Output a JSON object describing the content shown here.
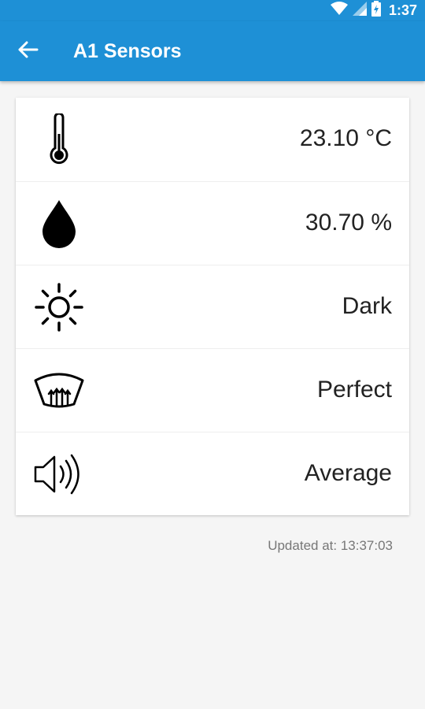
{
  "status_bar": {
    "time": "1:37",
    "icons": [
      "wifi-icon",
      "cell-signal-icon",
      "battery-icon"
    ]
  },
  "app_bar": {
    "title": "A1 Sensors",
    "back_icon": "arrow-left-icon",
    "color": "#1e90d6"
  },
  "sensors": [
    {
      "icon": "thermometer-icon",
      "value": "23.10 °C"
    },
    {
      "icon": "water-drop-icon",
      "value": "30.70 %"
    },
    {
      "icon": "sun-icon",
      "value": "Dark"
    },
    {
      "icon": "air-quality-icon",
      "value": "Perfect"
    },
    {
      "icon": "speaker-icon",
      "value": "Average"
    }
  ],
  "updated": "Updated at: 13:37:03"
}
